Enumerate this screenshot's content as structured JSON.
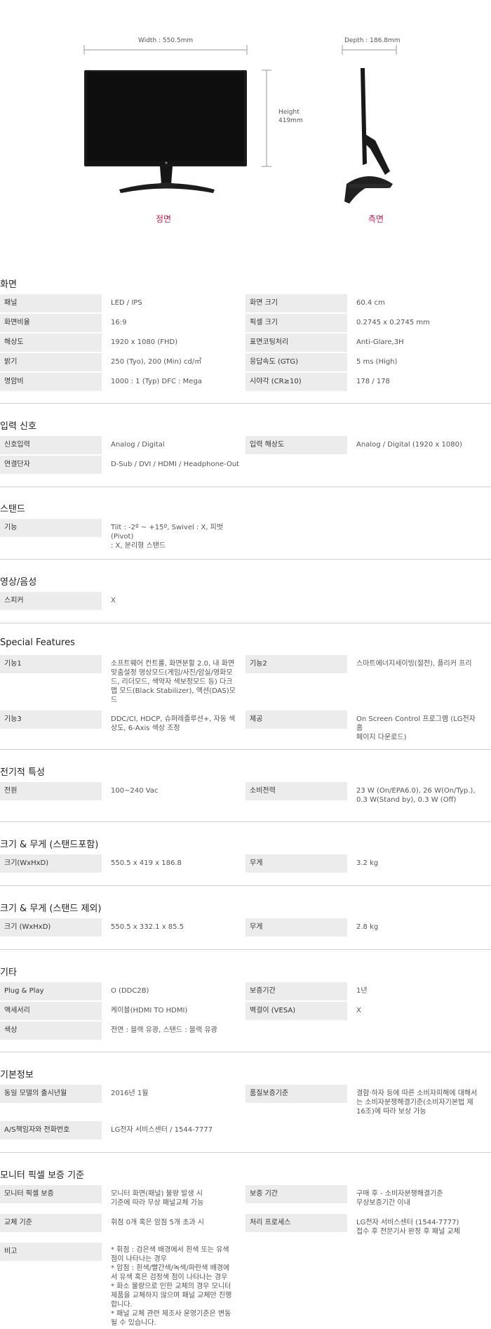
{
  "hero": {
    "width_label": "Width : 550.5mm",
    "height_label": "Height\n419mm",
    "depth_label": "Depth : 186.8mm",
    "front_caption": "정면",
    "side_caption": "측면"
  },
  "sections": [
    {
      "title": "화면",
      "rows": [
        {
          "l": "패널",
          "lv": "LED / IPS",
          "r": "화면 크기",
          "rv": "60.4 cm"
        },
        {
          "l": "화면비율",
          "lv": "16:9",
          "r": "픽셀 크기",
          "rv": "0.2745 x 0.2745 mm"
        },
        {
          "l": "해상도",
          "lv": "1920 x 1080 (FHD)",
          "r": "표면코팅처리",
          "rv": "Anti-Glare,3H"
        },
        {
          "l": "밝기",
          "lv": "250 (Tyo), 200 (Min) cd/㎡",
          "r": "응답속도 (GTG)",
          "rv": "5 ms (High)"
        },
        {
          "l": "명암비",
          "lv": "1000 : 1 (Typ) DFC : Mega",
          "r": "시야각 (CR≥10)",
          "rv": "178 / 178"
        }
      ]
    },
    {
      "title": "입력 신호",
      "rows": [
        {
          "l": "신호입력",
          "lv": "Analog / Digital",
          "r": "입력 해상도",
          "rv": "Analog / Digital (1920 x 1080)"
        },
        {
          "l": "연결단자",
          "lv": "D-Sub / DVI / HDMI / Headphone-Out",
          "r": "",
          "rv": ""
        }
      ]
    },
    {
      "title": "스탠드",
      "rows": [
        {
          "l": "기능",
          "lv": "Tilt : -2º ~ +15º, Swivel : X, 피벗(Pivot)\n: X, 분리형 스탠드",
          "r": "",
          "rv": ""
        }
      ]
    },
    {
      "title": "영상/음성",
      "rows": [
        {
          "l": "스피커",
          "lv": "X",
          "r": "",
          "rv": ""
        }
      ]
    },
    {
      "title": "Special Features",
      "rows": [
        {
          "l": "기능1",
          "lv": "소프트웨어 컨트롤, 화면분할 2.0, 내 화면\n맞춤설정 영상모드(게임/사진/암실/영화모\n드, 리더모드, 색약자 색보정모드 등) 다크\n맵 모드(Black Stabilizer), 액션(DAS)모\n드",
          "r": "기능2",
          "rv": "스마트에너지세이빙(절전), 플리커 프리"
        },
        {
          "l": "기능3",
          "lv": "DDC/CI, HDCP, 슈퍼레졸루션+, 자동 색\n상도, 6-Axis 색상 조정",
          "r": "제공",
          "rv": "On Screen Control 프로그램 (LG전자 홈\n페이지 다운로드)"
        }
      ]
    },
    {
      "title": "전기적 특성",
      "rows": [
        {
          "l": "전원",
          "lv": "100~240 Vac",
          "r": "소비전력",
          "rv": "23 W (On/EPA6.0), 26 W(On/Typ.),\n0.3 W(Stand by), 0.3 W (Off)"
        }
      ]
    },
    {
      "title": "크기 & 무게 (스탠드포함)",
      "rows": [
        {
          "l": "크기(WxHxD)",
          "lv": "550.5 x 419 x 186.8",
          "r": "무게",
          "rv": "3.2 kg"
        }
      ]
    },
    {
      "title": "크기 & 무게 (스탠드 제외)",
      "rows": [
        {
          "l": "크기 (WxHxD)",
          "lv": "550.5 x 332.1 x 85.5",
          "r": "무게",
          "rv": "2.8 kg"
        }
      ]
    },
    {
      "title": "기타",
      "rows": [
        {
          "l": "Plug & Play",
          "lv": "O (DDC2B)",
          "r": "보증기간",
          "rv": "1년"
        },
        {
          "l": "액세서리",
          "lv": "케이블(HDMI TO HDMI)",
          "r": "벽걸이 (VESA)",
          "rv": "X"
        },
        {
          "l": "색상",
          "lv": "전면 : 블랙 유광, 스탠드 : 블랙 유광",
          "r": "",
          "rv": ""
        }
      ]
    },
    {
      "title": "기본정보",
      "rows": [
        {
          "l": "동일 모델의 출시년월",
          "lv": "2016년 1월",
          "r": "품질보증기준",
          "rv": "결함·하자 등에 따른 소비자피해에 대해서\n는 소비자분쟁해결기준(소비자기본법 제\n16조)에 따라 보상 가능"
        },
        {
          "l": "A/S책임자와 전화번호",
          "lv": "LG전자 서비스센터 / 1544-7777",
          "r": "",
          "rv": ""
        }
      ]
    },
    {
      "title": "모니터 픽셀 보증 기준",
      "rows": [
        {
          "l": "모니터 픽셀 보증",
          "lv": "모니터 화면(패널) 불량 발생 시\n기준에 따라 무상 패널교체 가능",
          "r": "보증 기간",
          "rv": "구매 후 - 소비자분쟁해결기준\n무상보증기간 이내"
        },
        {
          "l": "교체 기준",
          "lv": "휘점 0개 혹은 암점 5개 초과 시",
          "r": "처리 프로세스",
          "rv": "LG전자 서비스센터 (1544-7777)\n접수 후 전문기사 판정 후 패널 교체"
        },
        {
          "l": "비고",
          "lv": "* 휘점 : 검은색 배경에서 흰색 또는 유색\n점이 나타나는 경우\n* 암점 : 흰색/빨간색/녹색/파란색 배경에\n서 유색 혹은 검정색 점이 나타나는 경우\n* 화소 불량으로 인한 교체의 경우 모니터\n제품을 교체하지 않으며 패널 교체만 진행\n합니다.\n* 패널 교체 관련 제조사 운영기준은 변동\n될 수 있습니다.",
          "r": "",
          "rv": ""
        }
      ]
    }
  ]
}
